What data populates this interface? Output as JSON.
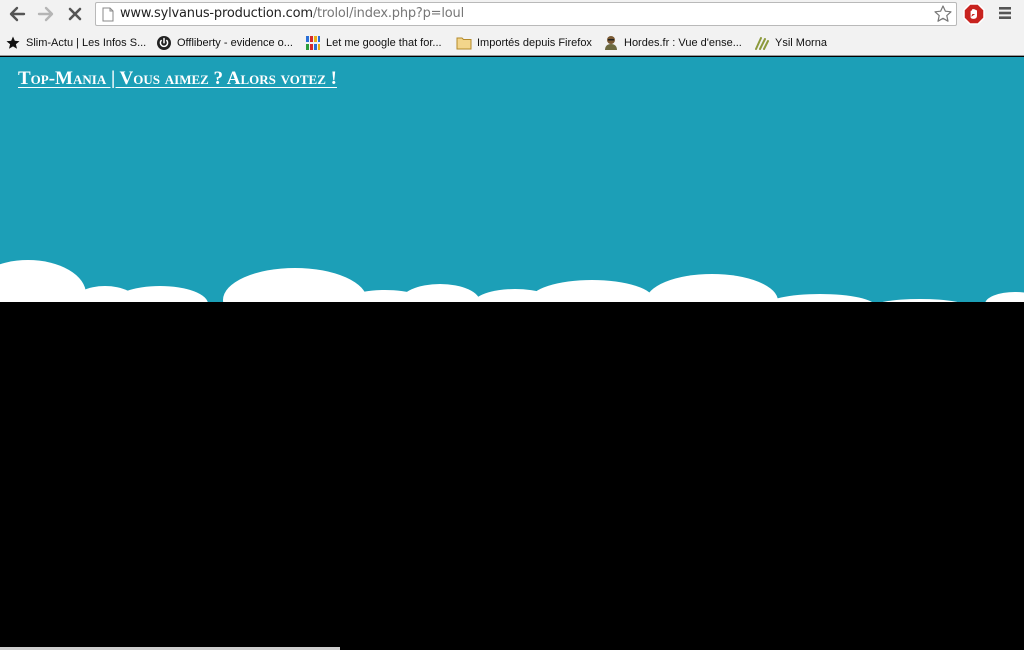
{
  "browser": {
    "url_host": "www.sylvanus-production.com",
    "url_path": "/trolol/index.php?p=loul"
  },
  "bookmarks": [
    {
      "label": "Slim-Actu | Les Infos S...",
      "icon": "star-icon"
    },
    {
      "label": "Offliberty - evidence o...",
      "icon": "power-icon"
    },
    {
      "label": "Let me google that for...",
      "icon": "lmgtfy-icon"
    },
    {
      "label": "Importés depuis Firefox",
      "icon": "folder-icon"
    },
    {
      "label": "Hordes.fr : Vue d'ense...",
      "icon": "hordes-icon"
    },
    {
      "label": "Ysil Morna",
      "icon": "ysil-icon"
    }
  ],
  "page": {
    "title_link": "Top-Mania | Vous aimez ? Alors votez !",
    "colors": {
      "sky": "#1c9fb7",
      "cloud": "#ffffff",
      "background": "#000000"
    }
  }
}
